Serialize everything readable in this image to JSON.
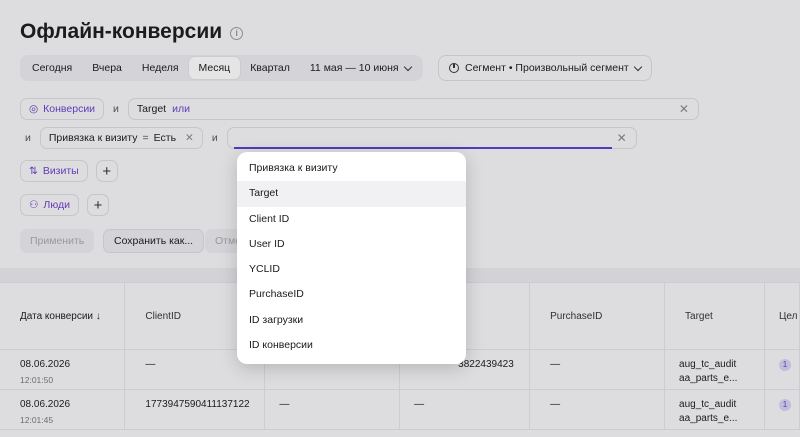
{
  "page": {
    "title": "Офлайн-конверсии",
    "info_icon": "info-icon"
  },
  "period": {
    "buttons": [
      "Сегодня",
      "Вчера",
      "Неделя",
      "Месяц",
      "Квартал"
    ],
    "active": "Месяц",
    "date_range": "11 мая — 10 июня"
  },
  "segment": {
    "label": "Сегмент • Произвольный сегмент"
  },
  "filters": {
    "row1": {
      "chip": "Конверсии",
      "op": "и",
      "field_tag": "Target",
      "field_op": "или"
    },
    "row2": {
      "op_lead": "и",
      "chip": "Привязка к визиту",
      "eq": "=",
      "value": "Есть",
      "op": "и",
      "input_value": ""
    },
    "row3": {
      "chip": "Визиты"
    },
    "row4": {
      "chip": "Люди"
    }
  },
  "actions": {
    "apply": "Применить",
    "save": "Сохранить как...",
    "cancel_partial": "Отме"
  },
  "table": {
    "columns": [
      "Дата конверсии ↓",
      "ClientID",
      "",
      "",
      "PurchaseID",
      "Target",
      "Цел"
    ],
    "rows": [
      {
        "date": "08.06.2026",
        "time": "12:01:50",
        "client_id": "—",
        "c3": "",
        "c4": "3822439423",
        "purchase_id": "—",
        "target_1": "aug_tc_audit",
        "target_2": "aa_parts_e...",
        "badge": "1"
      },
      {
        "date": "08.06.2026",
        "time": "12:01:45",
        "client_id": "1773947590411137122",
        "c3": "—",
        "c4": "—",
        "purchase_id": "—",
        "target_1": "aug_tc_audit",
        "target_2": "aa_parts_e...",
        "badge": "1"
      }
    ]
  },
  "dropdown": {
    "items": [
      "Привязка к визиту",
      "Target",
      "Client ID",
      "User ID",
      "YCLID",
      "PurchaseID",
      "ID загрузки",
      "ID конверсии"
    ],
    "highlighted": "Target"
  },
  "colors": {
    "accent": "#6b3fc9",
    "underline": "#5a3bd6"
  }
}
